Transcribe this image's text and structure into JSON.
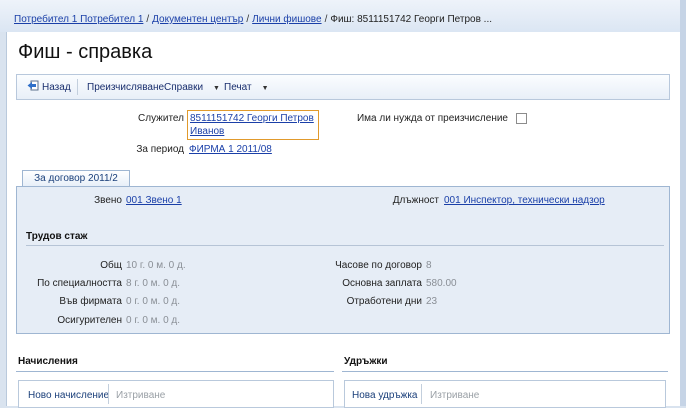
{
  "breadcrumb": {
    "items": [
      "Потребител 1 Потребител 1",
      "Документен център",
      "Лични фишове"
    ],
    "current": "Фиш: 8511151742 Георги Петров ..."
  },
  "page_title": "Фиш - справка",
  "toolbar": {
    "back_label": "Назад",
    "recalc_label": "Преизчисляване",
    "reports_label": "Справки",
    "print_label": "Печат"
  },
  "header": {
    "employee_label": "Служител",
    "employee_value_line1": "8511151742 Георги Петров",
    "employee_value_line2": "Иванов",
    "period_label": "За период",
    "period_value": "ФИРМА 1 2011/08",
    "recalc_needed_label": "Има ли нужда от преизчисление"
  },
  "tab": {
    "label": "За договор 2011/2"
  },
  "contract": {
    "unit_label": "Звено",
    "unit_value": "001 Звено 1",
    "position_label": "Длъжност",
    "position_value": "001 Инспектор, технически надзор"
  },
  "seniority": {
    "title": "Трудов стаж",
    "rows": [
      {
        "label": "Общ",
        "value": "10 г. 0 м. 0 д."
      },
      {
        "label": "По специалността",
        "value": "8 г. 0 м. 0 д."
      },
      {
        "label": "Във фирмата",
        "value": "0 г. 0 м. 0 д."
      },
      {
        "label": "Осигурителен",
        "value": "0 г. 0 м. 0 д."
      }
    ],
    "right_rows": [
      {
        "label": "Часове по договор",
        "value": "8"
      },
      {
        "label": "Основна заплата",
        "value": "580.00"
      },
      {
        "label": "Отработени дни",
        "value": "23"
      }
    ]
  },
  "accruals": {
    "title": "Начисления",
    "new_label": "Ново начисление",
    "delete_label": "Изтриване"
  },
  "deductions": {
    "title": "Удръжки",
    "new_label": "Нова удръжка",
    "delete_label": "Изтриване"
  }
}
